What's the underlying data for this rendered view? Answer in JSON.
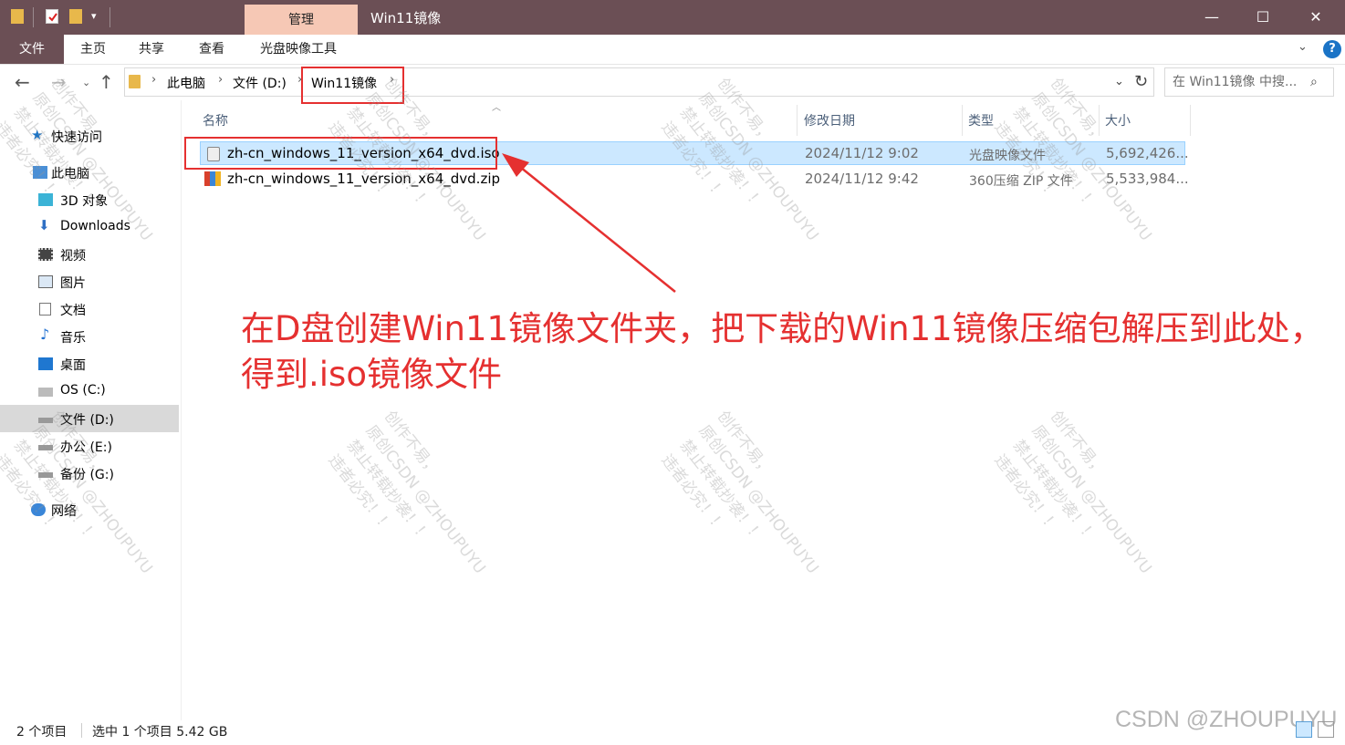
{
  "window": {
    "title": "Win11镜像",
    "context_tab": "管理",
    "minimize": "—",
    "maximize": "☐",
    "close": "✕"
  },
  "ribbon": {
    "tabs": [
      "文件",
      "主页",
      "共享",
      "查看",
      "光盘映像工具"
    ],
    "help": "?"
  },
  "address": {
    "crumbs": [
      "此电脑",
      "文件 (D:)",
      "Win11镜像"
    ],
    "search_placeholder": "在 Win11镜像 中搜..."
  },
  "sidebar": {
    "items": [
      {
        "label": "快速访问",
        "icon": "star-icon"
      },
      {
        "label": "此电脑",
        "icon": "computer-icon"
      },
      {
        "label": "3D 对象",
        "icon": "cube-icon"
      },
      {
        "label": "Downloads",
        "icon": "download-arrow-icon"
      },
      {
        "label": "视频",
        "icon": "film-icon"
      },
      {
        "label": "图片",
        "icon": "picture-icon"
      },
      {
        "label": "文档",
        "icon": "document-icon"
      },
      {
        "label": "音乐",
        "icon": "music-note-icon"
      },
      {
        "label": "桌面",
        "icon": "desktop-icon"
      },
      {
        "label": "OS (C:)",
        "icon": "windows-drive-icon"
      },
      {
        "label": "文件 (D:)",
        "icon": "drive-icon"
      },
      {
        "label": "办公 (E:)",
        "icon": "drive-icon"
      },
      {
        "label": "备份 (G:)",
        "icon": "drive-icon"
      },
      {
        "label": "网络",
        "icon": "network-icon"
      }
    ]
  },
  "columns": [
    "名称",
    "修改日期",
    "类型",
    "大小"
  ],
  "files": [
    {
      "name": "zh-cn_windows_11_version_x64_dvd.iso",
      "date": "2024/11/12 9:02",
      "type": "光盘映像文件",
      "size": "5,692,426...",
      "selected": true,
      "icon": "disc-image-icon"
    },
    {
      "name": "zh-cn_windows_11_version_x64_dvd.zip",
      "date": "2024/11/12 9:42",
      "type": "360压缩 ZIP 文件",
      "size": "5,533,984...",
      "selected": false,
      "icon": "zip-archive-icon"
    }
  ],
  "annotation": {
    "line1": "在D盘创建Win11镜像文件夹，把下载的Win11镜像压缩包解压到此处，",
    "line2": "得到.iso镜像文件",
    "color": "#e53030"
  },
  "status": {
    "count": "2 个项目",
    "selection": "选中 1 个项目  5.42 GB"
  },
  "watermark": {
    "lines": [
      "创作不易，",
      "原创CSDN @ZHOUPUYU",
      "禁止转载抄袭！！",
      "违者必究！！"
    ],
    "csdn": "CSDN @ZHOUPUYU"
  },
  "colors": {
    "titlebar": "#6b4f55",
    "context_tab": "#f6c8b5",
    "selection": "#cce8ff",
    "accent_red": "#e53030"
  }
}
